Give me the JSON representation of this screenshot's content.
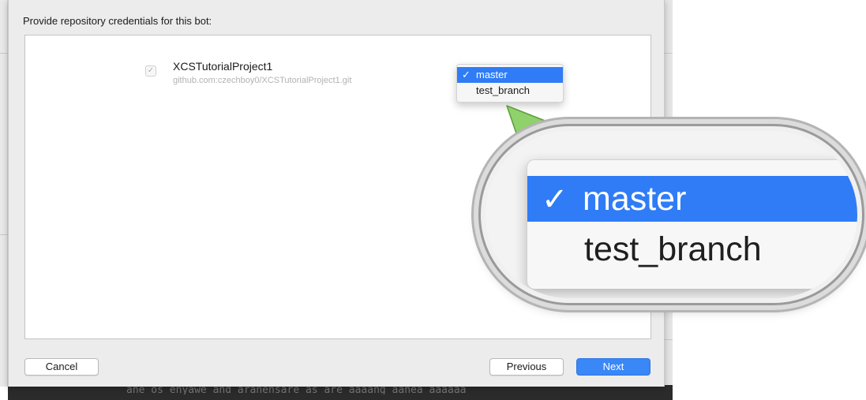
{
  "sheet": {
    "title": "Provide repository credentials for this bot:"
  },
  "repository": {
    "checked": true,
    "check_glyph": "✓",
    "name": "XCSTutorialProject1",
    "url": "github.com:czechboy0/XCSTutorialProject1.git"
  },
  "branch_menu": {
    "items": [
      {
        "label": "master",
        "selected": true,
        "check": "✓"
      },
      {
        "label": "test_branch",
        "selected": false
      }
    ]
  },
  "magnified_menu": {
    "items": [
      {
        "label": "master",
        "selected": true,
        "check": "✓"
      },
      {
        "label": "test_branch",
        "selected": false
      }
    ]
  },
  "buttons": {
    "cancel": "Cancel",
    "previous": "Previous",
    "next": "Next"
  },
  "background": {
    "terminal_text": "ane os enyawe and aranensare as are aaaang aanea aaaaaa"
  },
  "colors": {
    "accent": "#2f7cf6",
    "default_button": "#3a87f7",
    "callout_arrow": "#8fd16a"
  },
  "icons": {
    "checkmark": "checkmark-icon",
    "callout_arrow": "callout-arrow-icon"
  }
}
